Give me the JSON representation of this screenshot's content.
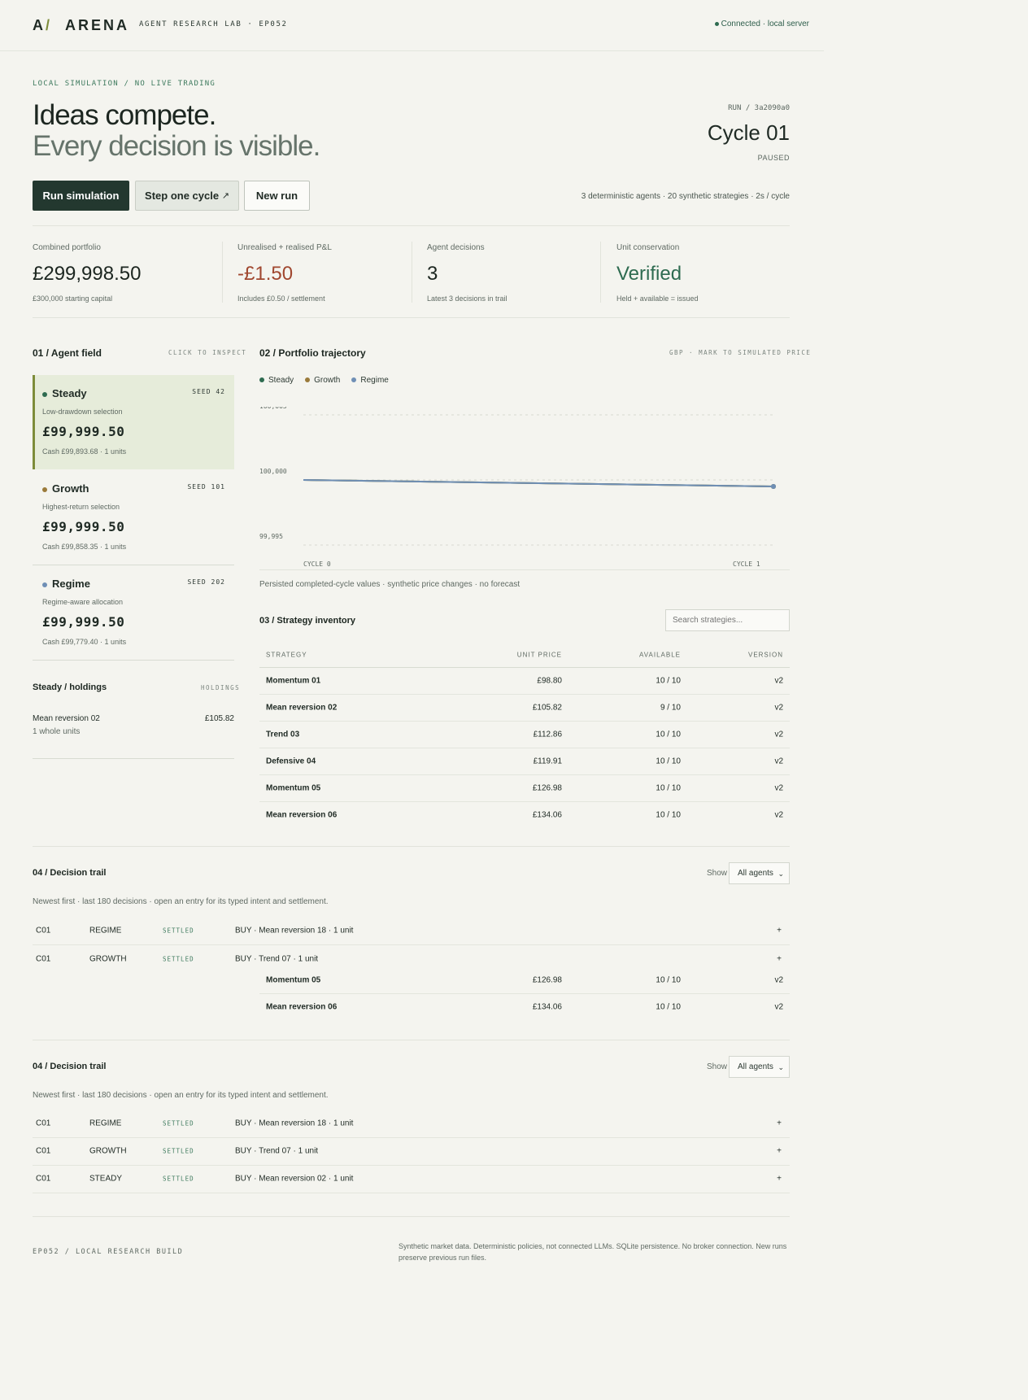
{
  "header": {
    "logo_mark": "A",
    "logo_slash": "/",
    "logo_word": "ARENA",
    "lab": "AGENT RESEARCH LAB · EP052",
    "connection": "Connected · local server"
  },
  "hero": {
    "kicker": "LOCAL SIMULATION / NO LIVE TRADING",
    "title_1": "Ideas compete.",
    "title_2": "Every decision is visible.",
    "run_id": "RUN / 3a2090a0",
    "cycle": "Cycle 01",
    "state": "PAUSED"
  },
  "actions": {
    "run": "Run simulation",
    "step": "Step one cycle",
    "step_icon": "↗",
    "new": "New run",
    "meta": "3 deterministic agents · 20 synthetic strategies · 2s / cycle"
  },
  "kpis": [
    {
      "label": "Combined portfolio",
      "value": "£299,998.50",
      "sub": "£300,000 starting capital",
      "color": "#1c2620"
    },
    {
      "label": "Unrealised + realised P&L",
      "value": "-£1.50",
      "sub": "Includes £0.50 / settlement",
      "color": "#a0472f"
    },
    {
      "label": "Agent decisions",
      "value": "3",
      "sub": "Latest 3 decisions in trail",
      "color": "#1c2620"
    },
    {
      "label": "Unit conservation",
      "value": "Verified",
      "sub": "Held + available = issued",
      "color": "#2e6b50"
    }
  ],
  "agent_field": {
    "title": "01 / Agent field",
    "tag": "CLICK TO INSPECT",
    "agents": [
      {
        "name": "Steady",
        "seed": "SEED 42",
        "desc": "Low-drawdown selection",
        "value": "£99,999.50",
        "cash": "Cash £99,893.68 · 1 units",
        "color": "#2e6b50"
      },
      {
        "name": "Growth",
        "seed": "SEED 101",
        "desc": "Highest-return selection",
        "value": "£99,999.50",
        "cash": "Cash £99,858.35 · 1 units",
        "color": "#9a7a3a"
      },
      {
        "name": "Regime",
        "seed": "SEED 202",
        "desc": "Regime-aware allocation",
        "value": "£99,999.50",
        "cash": "Cash £99,779.40 · 1 units",
        "color": "#6f8fb5"
      }
    ]
  },
  "holdings": {
    "title": "Steady / holdings",
    "tag": "HOLDINGS",
    "items": [
      {
        "name": "Mean reversion 02",
        "units": "1 whole units",
        "value": "£105.82"
      }
    ]
  },
  "trajectory": {
    "title": "02 / Portfolio trajectory",
    "tag": "GBP · MARK TO SIMULATED PRICE",
    "note": "Persisted completed-cycle values · synthetic price changes · no forecast"
  },
  "chart_data": {
    "type": "line",
    "x": [
      "CYCLE 0",
      "CYCLE 1"
    ],
    "series": [
      {
        "name": "Steady",
        "values": [
          100000,
          99999.5
        ],
        "color": "#2e6b50"
      },
      {
        "name": "Growth",
        "values": [
          100000,
          99999.5
        ],
        "color": "#9a7a3a"
      },
      {
        "name": "Regime",
        "values": [
          100000,
          99999.5
        ],
        "color": "#6f8fb5"
      }
    ],
    "yticks": [
      99995,
      100000,
      100005
    ],
    "ytick_labels": [
      "99,995",
      "100,000",
      "100,005"
    ],
    "ylim": [
      99995,
      100005
    ],
    "grid": true,
    "legend": "top-left"
  },
  "inventory": {
    "title": "03 / Strategy inventory",
    "search_placeholder": "Search strategies...",
    "headers": [
      "STRATEGY",
      "UNIT PRICE",
      "AVAILABLE",
      "VERSION"
    ],
    "rows": [
      [
        "Momentum 01",
        "£98.80",
        "10 / 10",
        "v2"
      ],
      [
        "Mean reversion 02",
        "£105.82",
        "9 / 10",
        "v2"
      ],
      [
        "Trend 03",
        "£112.86",
        "10 / 10",
        "v2"
      ],
      [
        "Defensive 04",
        "£119.91",
        "10 / 10",
        "v2"
      ],
      [
        "Momentum 05",
        "£126.98",
        "10 / 10",
        "v2"
      ],
      [
        "Mean reversion 06",
        "£134.06",
        "10 / 10",
        "v2"
      ]
    ]
  },
  "trail_1": {
    "title": "04 / Decision trail",
    "show": "Show",
    "filter": "All agents",
    "note": "Newest first · last 180 decisions · open an entry for its typed intent and settlement.",
    "rows": [
      [
        "C01",
        "REGIME",
        "SETTLED",
        "BUY · Mean reversion 18 · 1 unit",
        "+"
      ],
      [
        "C01",
        "GROWTH",
        "SETTLED",
        "BUY · Trend 07 · 1 unit",
        "+"
      ]
    ],
    "overflow_rows": [
      [
        "Momentum 05",
        "£126.98",
        "10 / 10",
        "v2"
      ],
      [
        "Mean reversion 06",
        "£134.06",
        "10 / 10",
        "v2"
      ]
    ]
  },
  "trail_2": {
    "title": "04 / Decision trail",
    "show": "Show",
    "filter": "All agents",
    "note": "Newest first · last 180 decisions · open an entry for its typed intent and settlement.",
    "rows": [
      [
        "C01",
        "REGIME",
        "SETTLED",
        "BUY · Mean reversion 18 · 1 unit",
        "+"
      ],
      [
        "C01",
        "GROWTH",
        "SETTLED",
        "BUY · Trend 07 · 1 unit",
        "+"
      ],
      [
        "C01",
        "STEADY",
        "SETTLED",
        "BUY · Mean reversion 02 · 1 unit",
        "+"
      ]
    ]
  },
  "footer": {
    "left": "EP052 / LOCAL RESEARCH BUILD",
    "right": "Synthetic market data. Deterministic policies, not connected LLMs. SQLite persistence. No broker connection. New runs preserve previous run files."
  }
}
